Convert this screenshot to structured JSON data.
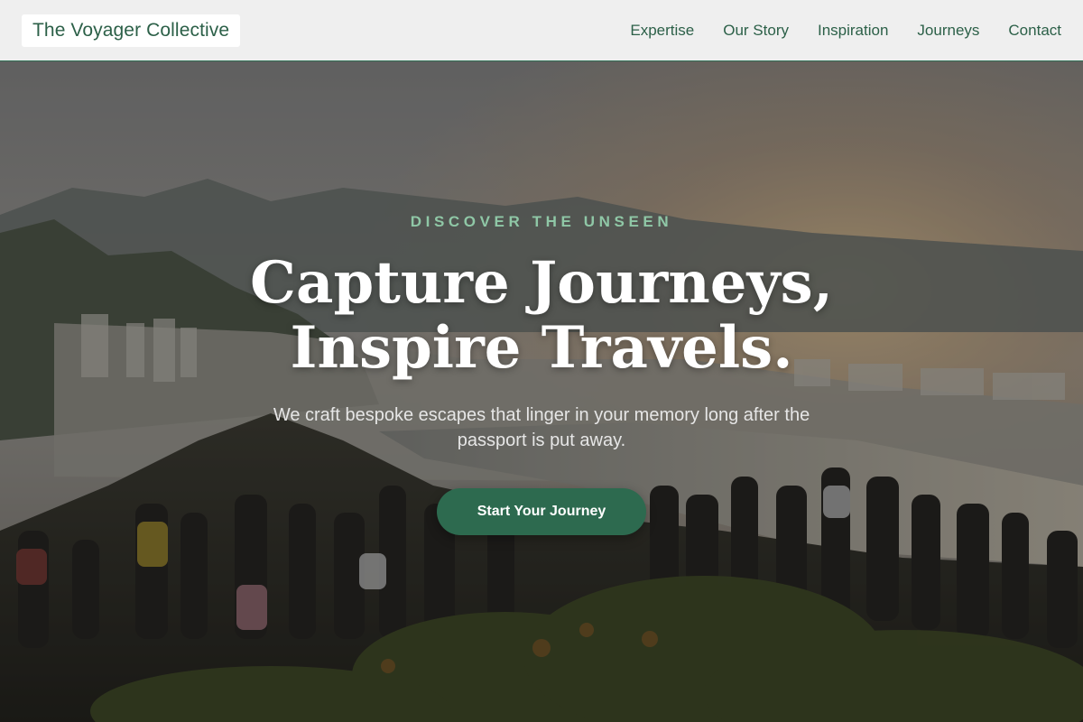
{
  "header": {
    "logo": "The Voyager Collective",
    "nav": [
      {
        "label": "Expertise"
      },
      {
        "label": "Our Story"
      },
      {
        "label": "Inspiration"
      },
      {
        "label": "Journeys"
      },
      {
        "label": "Contact"
      }
    ]
  },
  "hero": {
    "eyebrow": "DISCOVER THE UNSEEN",
    "headline_line1": "Capture Journeys,",
    "headline_line2": "Inspire Travels.",
    "subtitle": "We craft bespoke escapes that linger in your memory long after the passport is put away.",
    "cta_label": "Start Your Journey"
  },
  "colors": {
    "brand_green": "#2d6a4f",
    "eyebrow_green": "#8fc7a6",
    "header_bg": "#efefef"
  }
}
